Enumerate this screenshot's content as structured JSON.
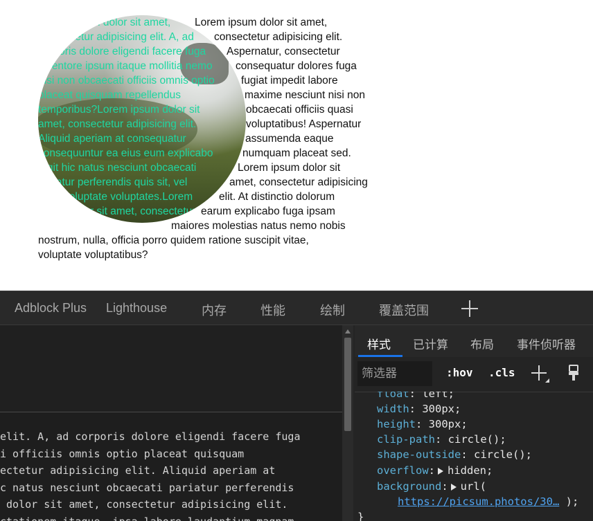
{
  "preview": {
    "circle_text": "Lorem ipsum dolor sit amet,\nconsectetur adipisicing elit. A, ad\ncorporis dolore eligendi facere fuga\ninventore ipsum itaque mollitia nemo\nnisi non obcaecati officiis omnis optio\nplaceat quisquam repellendus\ntemporibus?Lorem ipsum dolor sit\namet, consectetur adipisicing elit.\nAliquid aperiam at consequatur\nconsequuntur ea eius eum explicabo\nfugit hic natus nesciunt obcaecati\npariatur perferendis quis sit, vel\nvitae voluptate voluptates.Lorem\nipsum dolor sit amet, consectetur",
    "float_lines": [
      "Lorem ipsum dolor sit amet,",
      "consectetur adipisicing elit.",
      "Aspernatur, consectetur",
      "consequatur dolores fuga",
      "fugiat impedit labore",
      "maxime nesciunt nisi non",
      "obcaecati officiis quasi",
      "voluptatibus! Aspernatur",
      "assumenda eaque",
      "numquam placeat sed.",
      "Lorem ipsum dolor sit",
      "amet, consectetur adipisicing",
      "elit. At distinctio dolorum",
      "earum explicabo fuga ipsam",
      "maiores molestias natus nemo nobis",
      "nostrum, nulla, officia porro quidem ratione suscipit vitae,",
      "voluptate voluptatibus?"
    ]
  },
  "devtools": {
    "tabs": [
      "Adblock Plus",
      "Lighthouse",
      "内存",
      "性能",
      "绘制",
      "覆盖范围"
    ],
    "code_lines": [
      "elit. A, ad corporis dolore eligendi facere fuga",
      "i officiis omnis optio placeat quisquam",
      "ectetur adipisicing elit. Aliquid aperiam at",
      "c natus nesciunt obcaecati pariatur perferendis",
      " dolor sit amet, consectetur adipisicing elit.",
      "ctationem itaque, ipsa labore laudantium magnam"
    ],
    "styles_panel": {
      "tabs": [
        "样式",
        "已计算",
        "布局",
        "事件侦听器"
      ],
      "filter_placeholder": "筛选器",
      "hov_label": ":hov",
      "cls_label": ".cls",
      "declarations": [
        {
          "prop": "float",
          "value": "left;"
        },
        {
          "prop": "width",
          "value": "300px;"
        },
        {
          "prop": "height",
          "value": "300px;"
        },
        {
          "prop": "clip-path",
          "value": "circle();"
        },
        {
          "prop": "shape-outside",
          "value": "circle();"
        },
        {
          "prop": "overflow",
          "value": "hidden;"
        },
        {
          "prop": "background",
          "value": "url("
        }
      ],
      "url_text": "https://picsum.photos/30…",
      "url_close": ");",
      "close_brace": "}"
    }
  },
  "colors": {
    "circle_text": "#1fd6a1",
    "prop": "#5db0d7",
    "link": "#4fa3f0",
    "active_tab_underline": "#1a73e8"
  }
}
